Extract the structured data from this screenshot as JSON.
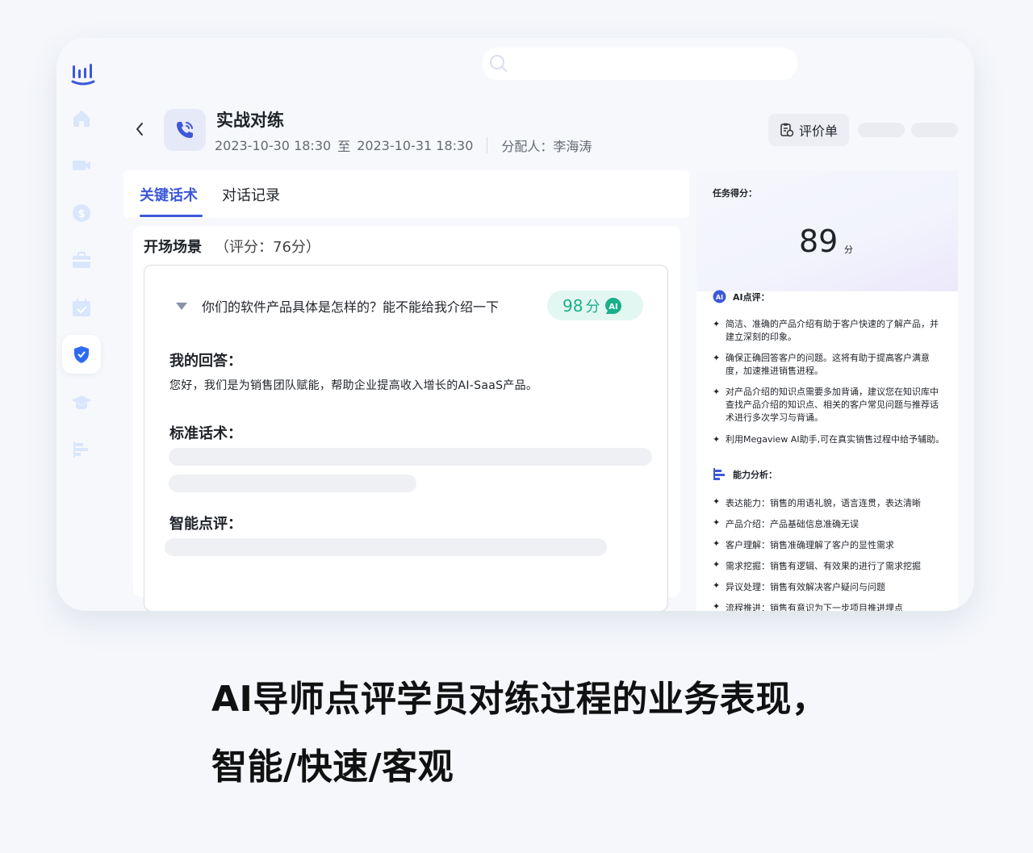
{
  "header": {
    "title": "实战对练",
    "start": "2023-10-30 18:30",
    "to": "至",
    "end": "2023-10-31 18:30",
    "assignee": "分配人：李海涛",
    "eval_button": "评价单"
  },
  "tabs": [
    {
      "label": "关键话术"
    },
    {
      "label": "对话记录"
    }
  ],
  "section": {
    "title": "开场场景",
    "score": "（评分：76分）",
    "question": "你们的软件产品具体是怎样的？能不能给我介绍一下",
    "badge_score": "98",
    "badge_unit": "分",
    "badge_ai": "AI",
    "my_answer_label": "我的回答：",
    "my_answer": "您好，我们是为销售团队赋能，帮助企业提高收入增长的AI-SaaS产品。",
    "standard_label": "标准话术：",
    "smart_label": "智能点评："
  },
  "right": {
    "task_score_label": "任务得分：",
    "score": "89",
    "score_unit": "分",
    "ai_review_label": "AI点评：",
    "ai_icon_text": "AI",
    "ai_review_items": [
      "简洁、准确的产品介绍有助于客户快速的了解产品，并建立深刻的印象。",
      "确保正确回答客户的问题。这将有助于提高客户满意度，加速推进销售进程。",
      "对产品介绍的知识点需要多加背诵，建议您在知识库中查找产品介绍的知识点、相关的客户常见问题与推荐话术进行多次学习与背诵。",
      "利用Megaview AI助手,可在真实销售过程中给予辅助。"
    ],
    "ability_label": "能力分析：",
    "abilities": [
      "表达能力：销售的用语礼貌，语言连贯，表达清晰",
      "产品介绍：产品基础信息准确无误",
      "客户理解：销售准确理解了客户的显性需求",
      "需求挖掘：销售有逻辑、有效果的进行了需求挖掘",
      "异议处理：销售有效解决客户疑问与问题",
      "流程推进：销售有意识为下一步项目推进埋点"
    ]
  },
  "caption": {
    "line1": "AI导师点评学员对练过程的业务表现，",
    "line2": "智能/快速/客观"
  },
  "colors": {
    "accent": "#3d58d8",
    "score_green": "#19b08a",
    "sidebar_icon": "#d9e6fb"
  }
}
